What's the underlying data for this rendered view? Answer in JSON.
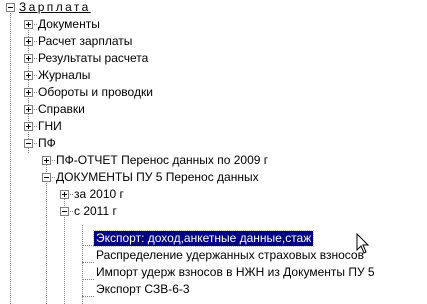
{
  "tree": {
    "root": "Зарплата",
    "items": [
      {
        "label": "Документы",
        "state": "collapsed"
      },
      {
        "label": "Расчет зарплаты",
        "state": "collapsed"
      },
      {
        "label": "Результаты расчета",
        "state": "collapsed"
      },
      {
        "label": "Журналы",
        "state": "collapsed"
      },
      {
        "label": "Обороты и проводки",
        "state": "collapsed"
      },
      {
        "label": "Справки",
        "state": "collapsed"
      },
      {
        "label": "ГНИ",
        "state": "collapsed"
      },
      {
        "label": "ПФ",
        "state": "expanded",
        "children": [
          {
            "label": "ПФ-ОТЧЕТ Перенос данных по 2009 г",
            "state": "collapsed"
          },
          {
            "label": "ДОКУМЕНТЫ ПУ 5 Перенос данных",
            "state": "expanded",
            "children": [
              {
                "label": "за 2010 г",
                "state": "collapsed"
              },
              {
                "label": "с 2011 г",
                "state": "expanded",
                "children": [
                  {
                    "label": "Экспорт: доход,анкетные данные,стаж",
                    "selected": true
                  },
                  {
                    "label": "Распределение удержанных страховых взносов"
                  },
                  {
                    "label": "Импорт удерж взносов в НЖН из Документы ПУ 5"
                  },
                  {
                    "label": "Экспорт СЗВ-6-3"
                  }
                ]
              }
            ]
          }
        ]
      }
    ]
  },
  "colors": {
    "selection_bg": "#000080",
    "selection_fg": "#ffffff",
    "tree_lines": "#808080"
  }
}
